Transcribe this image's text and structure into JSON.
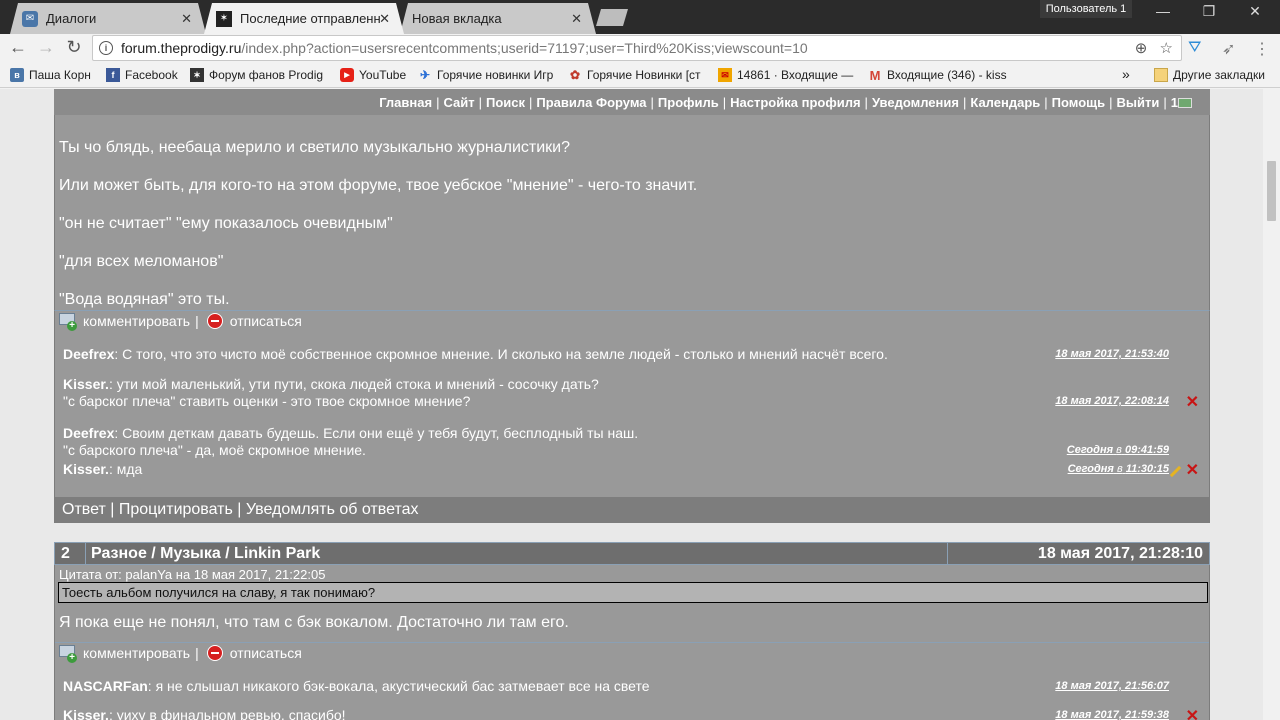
{
  "browser": {
    "tabs": [
      {
        "title": "Диалоги",
        "icon": "vk-icon"
      },
      {
        "title": "Последние отправленн",
        "icon": "prodigy-icon"
      },
      {
        "title": "Новая вкладка",
        "icon": ""
      }
    ],
    "profile": "Пользователь 1",
    "window_controls": {
      "minimize": "—",
      "maximize": "❐",
      "close": "✕"
    },
    "nav": {
      "back": "←",
      "forward": "→",
      "reload": "↻"
    },
    "url_host": "forum.theprodigy.ru",
    "url_path": "/index.php?action=usersrecentcomments;userid=71197;user=Third%20Kiss;viewscount=10",
    "omni_icons": {
      "zoom": "⊕",
      "star": "☆"
    },
    "bookmarks": [
      {
        "label": "Паша Корн",
        "icon": "vk-icon",
        "color": "#4a76a8"
      },
      {
        "label": "Facebook",
        "icon": "facebook-icon",
        "color": "#3b5998"
      },
      {
        "label": "Форум фанов Prodig",
        "icon": "prodigy-icon",
        "color": "#333333"
      },
      {
        "label": "YouTube",
        "icon": "youtube-icon",
        "color": "#e62117"
      },
      {
        "label": "Горячие новинки Игр",
        "icon": "game-icon",
        "color": "#2a6fd6"
      },
      {
        "label": "Горячие Новинки [ст",
        "icon": "game2-icon",
        "color": "#c0392b"
      },
      {
        "label": "14861 · Входящие —",
        "icon": "mail-icon",
        "color": "#f0a500"
      },
      {
        "label": "Входящие (346) - kiss",
        "icon": "gmail-icon",
        "color": "#d44638"
      }
    ],
    "bookmarks_overflow": "»",
    "other_bookmarks": "Другие закладки"
  },
  "forum": {
    "menu": [
      "Главная",
      "Сайт",
      "Поиск",
      "Правила Форума",
      "Профиль",
      "Настройка профиля",
      "Уведомления",
      "Календарь",
      "Помощь",
      "Выйти"
    ],
    "menu_pm_count": "1",
    "post1": {
      "lines": [
        "Ты чо блядь, неебаца мерило и светило музыкально журналистики?",
        "Или может быть, для кого-то на этом форуме, твое уебское \"мнение\" - чего-то значит.",
        "\"он не считает\" \"ему показалось очевидным\"",
        "\"для всех меломанов\"",
        "\"Вода водяная\" это ты."
      ],
      "comment_label": "комментировать",
      "unsubscribe_label": "отписаться",
      "comments": [
        {
          "author": "Deefrex",
          "lines": [
            "С того, что это чисто моё собственное скромное мнение. И сколько на земле людей - столько и мнений насчёт всего."
          ],
          "time": "18 мая 2017, 21:53:40"
        },
        {
          "author": "Kisser.",
          "lines": [
            "ути мой маленький, ути пути, скока людей стока и мнений - сосочку дать?",
            "\"с барског плеча\" ставить оценки - это твое скромное мнение?"
          ],
          "time": "18 мая 2017, 22:08:14"
        },
        {
          "author": "Deefrex",
          "lines": [
            "Своим деткам давать будешь. Если они ещё у тебя будут, бесплодный ты наш.",
            "\"с барского плеча\" - да, моё скромное мнение."
          ],
          "time_bold": "Сегодня",
          "time_in": "в",
          "time_clock": "09:41:59"
        },
        {
          "author": "Kisser.",
          "lines": [
            "мда"
          ],
          "time_bold": "Сегодня",
          "time_in": "в",
          "time_clock": "11:30:15"
        }
      ],
      "actions": [
        "Ответ",
        "Процитировать",
        "Уведомлять об ответах"
      ]
    },
    "post2": {
      "number": "2",
      "path": "Разное / Музыка / Linkin Park",
      "date": "18 мая 2017, 21:28:10",
      "quote_header": "Цитата от: palanYa на 18 мая 2017, 21:22:05",
      "quote_text": "Тоесть альбом получился на славу,  я так понимаю?",
      "text": "Я пока еще не понял, что там с бэк вокалом. Достаточно ли там его.",
      "comment_label": "комментировать",
      "unsubscribe_label": "отписаться",
      "comments": [
        {
          "author": "NASCARFan",
          "lines": [
            "я не слышал никакого бэк-вокала, акустический бас затмевает все на свете"
          ],
          "time": "18 мая 2017, 21:56:07"
        },
        {
          "author": "Kisser.",
          "lines": [
            "уиху в финальном ревью, спасибо!"
          ],
          "time": "18 мая 2017, 21:59:38"
        }
      ]
    }
  }
}
